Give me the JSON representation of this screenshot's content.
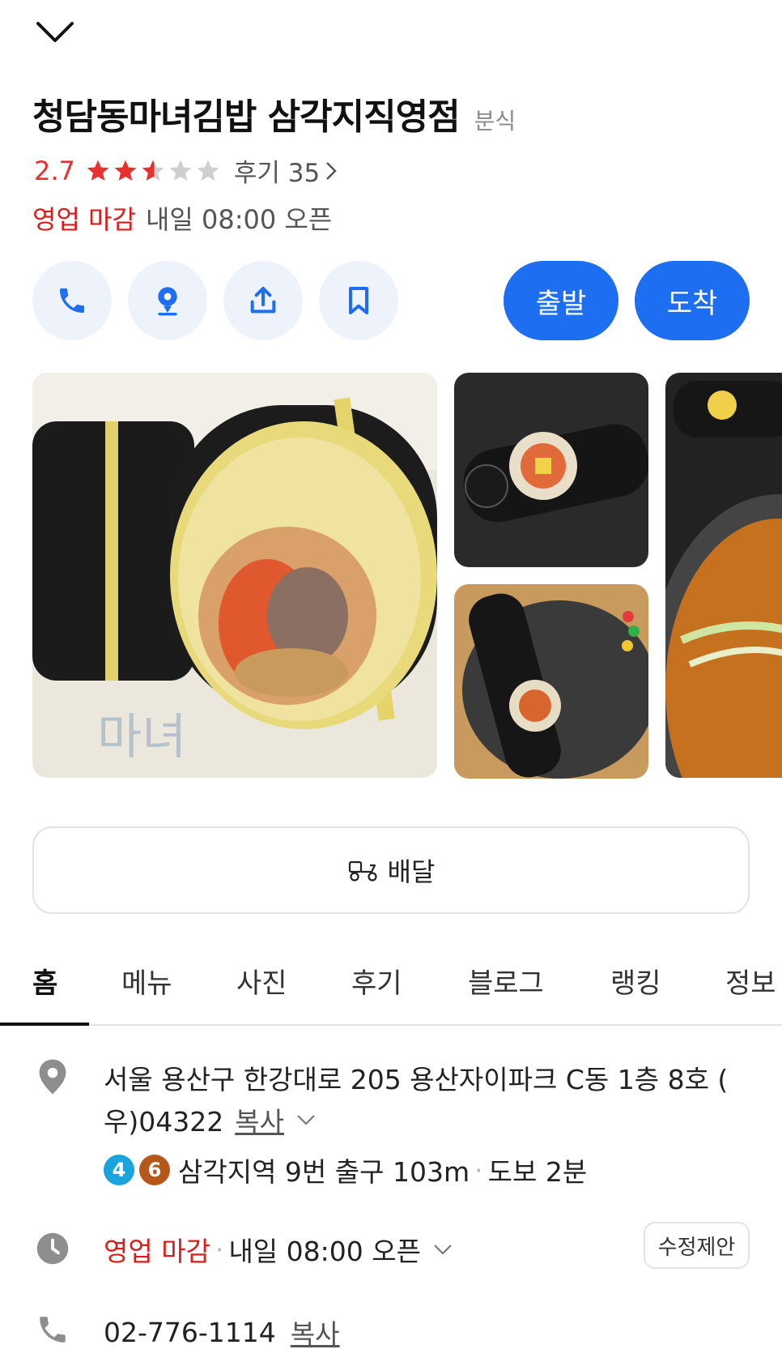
{
  "header": {
    "collapse_icon": "chevron-down-icon"
  },
  "place": {
    "name": "청담동마녀김밥 삼각지직영점",
    "category": "분식",
    "rating": "2.7",
    "rating_value": 2.7,
    "rating_max": 5,
    "review_label": "후기 35",
    "status_closed": "영업 마감",
    "status_next": "내일 08:00 오픈"
  },
  "actions": {
    "icons": [
      "phone-icon",
      "location-pin-icon",
      "share-icon",
      "bookmark-icon"
    ],
    "depart_label": "출발",
    "arrive_label": "도착"
  },
  "delivery": {
    "label": "배달",
    "icon": "delivery-scooter-icon"
  },
  "tabs": [
    {
      "label": "홈",
      "active": true
    },
    {
      "label": "메뉴"
    },
    {
      "label": "사진"
    },
    {
      "label": "후기"
    },
    {
      "label": "블로그"
    },
    {
      "label": "랭킹"
    },
    {
      "label": "정보"
    }
  ],
  "address": {
    "line1": "서울 용산구 한강대로 205 용산자이파크 C동 1층 8호 (",
    "line2": "우)04322",
    "copy_label": "복사",
    "subway_lines": [
      "4",
      "6"
    ],
    "subway_colors": [
      "#1ba3dd",
      "#b5591a"
    ],
    "subway_text": "삼각지역 9번 출구 103m",
    "walk_text": "도보 2분"
  },
  "hours": {
    "status": "영업 마감",
    "next": "내일 08:00 오픈",
    "suggest_label": "수정제안"
  },
  "phone": {
    "number": "02-776-1114",
    "copy_label": "복사"
  },
  "colors": {
    "accent": "#1d6ef0",
    "closed_red": "#d91c1c",
    "rating_red": "#e8312f"
  }
}
